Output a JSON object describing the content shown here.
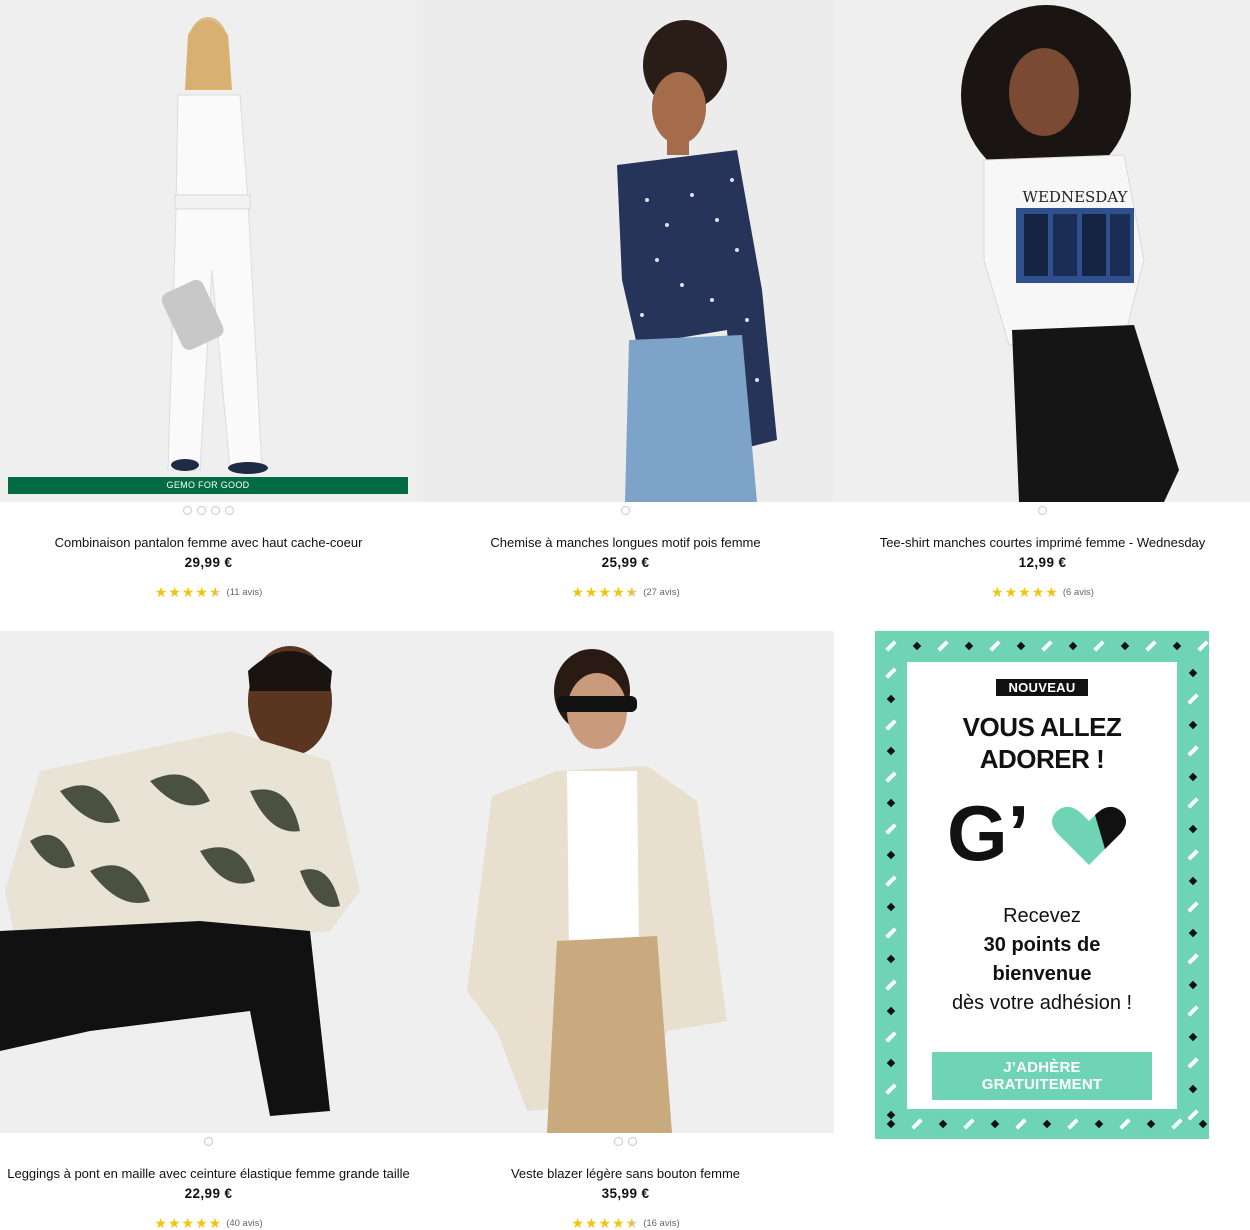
{
  "products": [
    {
      "badge": "GEMO FOR GOOD",
      "dots": 4,
      "title": "Combinaison pantalon femme avec haut cache-coeur",
      "price": "29,99 €",
      "rating": 4.5,
      "reviews": "(11 avis)"
    },
    {
      "badge": "",
      "dots": 1,
      "title": "Chemise à manches longues motif pois femme",
      "price": "25,99 €",
      "rating": 4.5,
      "reviews": "(27 avis)"
    },
    {
      "badge": "",
      "dots": 1,
      "title": "Tee-shirt manches courtes imprimé femme - Wednesday",
      "price": "12,99 €",
      "rating": 5,
      "reviews": "(6 avis)"
    },
    {
      "badge": "",
      "dots": 1,
      "title": "Leggings à pont en maille avec ceinture élastique femme grande taille",
      "price": "22,99 €",
      "rating": 5,
      "reviews": "(40 avis)"
    },
    {
      "badge": "",
      "dots": 2,
      "title": "Veste blazer légère sans bouton femme",
      "price": "35,99 €",
      "rating": 4.5,
      "reviews": "(16 avis)"
    }
  ],
  "promo": {
    "tag": "NOUVEAU",
    "headline_1": "VOUS ALLEZ",
    "headline_2": "ADORER !",
    "logo_text": "G’",
    "text_1": "Recevez",
    "text_2": "30 points de",
    "text_3": "bienvenue",
    "text_4": "dès votre adhésion !",
    "cta": "J’ADHÈRE GRATUITEMENT",
    "accent_color": "#6fd4b3"
  },
  "tee_print": "WEDNESDAY",
  "colors": {
    "badge_green": "#006b45",
    "star": "#f1c40f"
  }
}
